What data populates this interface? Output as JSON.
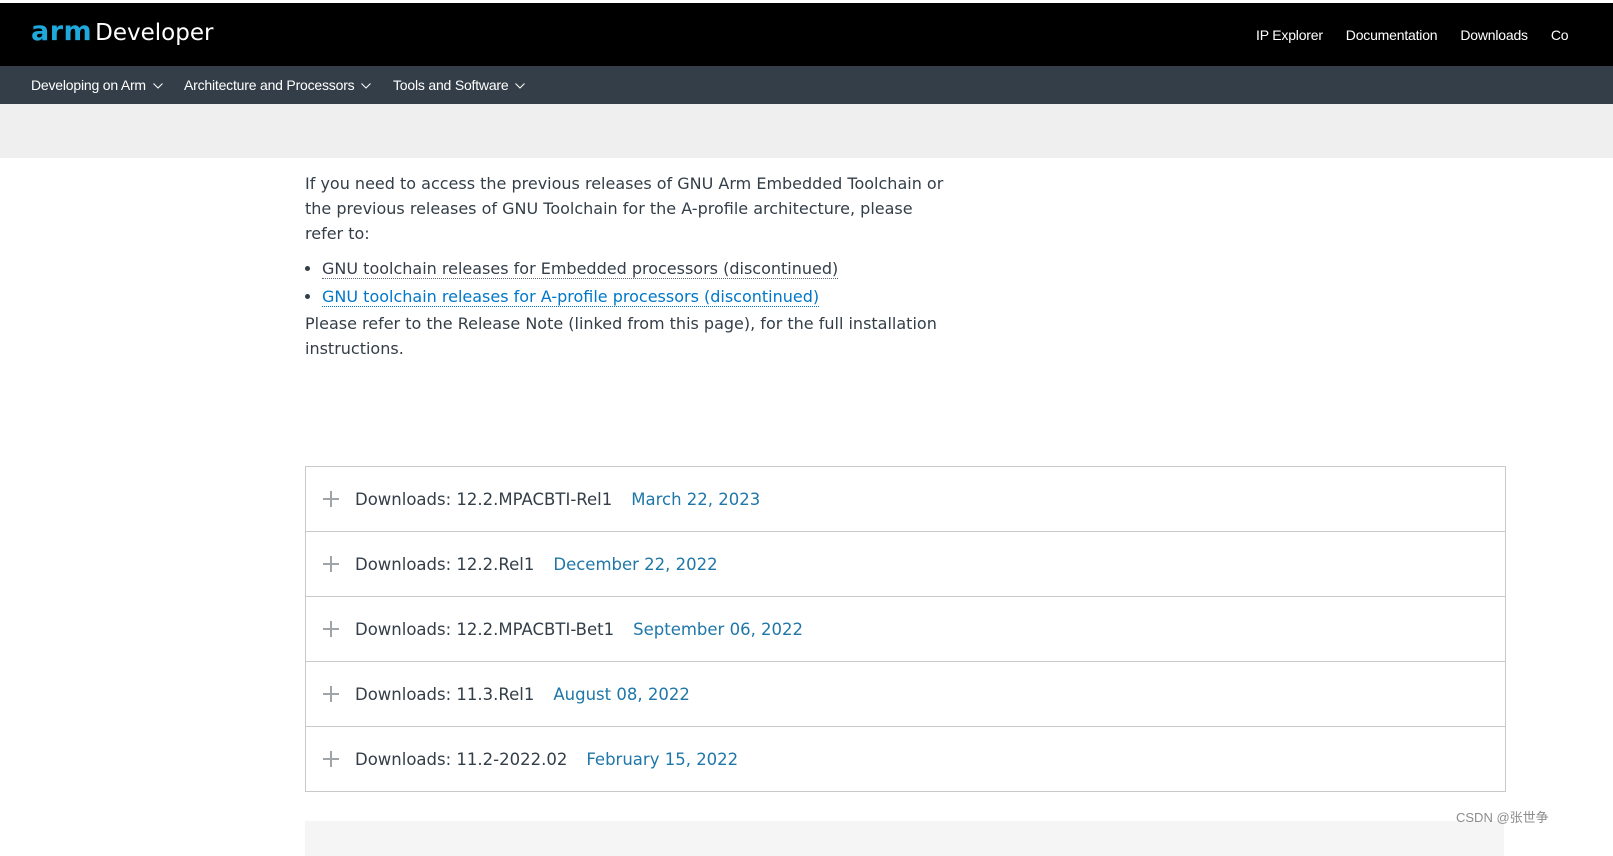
{
  "header": {
    "logo_arm": "arm",
    "logo_developer": "Developer",
    "links": [
      "IP Explorer",
      "Documentation",
      "Downloads",
      "Co"
    ]
  },
  "subnav": {
    "items": [
      "Developing on Arm",
      "Architecture and Processors",
      "Tools and Software"
    ]
  },
  "content": {
    "intro": "If you need to access the previous releases of GNU Arm Embedded Toolchain or the previous releases of GNU Toolchain for the A-profile architecture, please refer to:",
    "links": [
      "GNU toolchain releases for Embedded processors (discontinued)",
      "GNU toolchain releases for A-profile processors (discontinued)"
    ],
    "note": "Please refer to the Release Note (linked from this page), for the full installation instructions."
  },
  "downloads": [
    {
      "title": "Downloads: 12.2.MPACBTI-Rel1",
      "date": "March 22, 2023"
    },
    {
      "title": "Downloads: 12.2.Rel1",
      "date": "December 22, 2022"
    },
    {
      "title": "Downloads: 12.2.MPACBTI-Bet1",
      "date": "September 06, 2022"
    },
    {
      "title": "Downloads: 11.3.Rel1",
      "date": "August 08, 2022"
    },
    {
      "title": "Downloads: 11.2-2022.02",
      "date": "February 15, 2022"
    }
  ],
  "watermark": "CSDN @张世争",
  "colors": {
    "topbar": "#000000",
    "subnav": "#333e48",
    "logo_accent": "#1fa8db",
    "link_blue": "#0077c8",
    "date_blue": "#1f77a9"
  },
  "icons": {
    "accordion_expand": "plus-icon",
    "subnav_dropdown": "chevron-down-icon"
  }
}
